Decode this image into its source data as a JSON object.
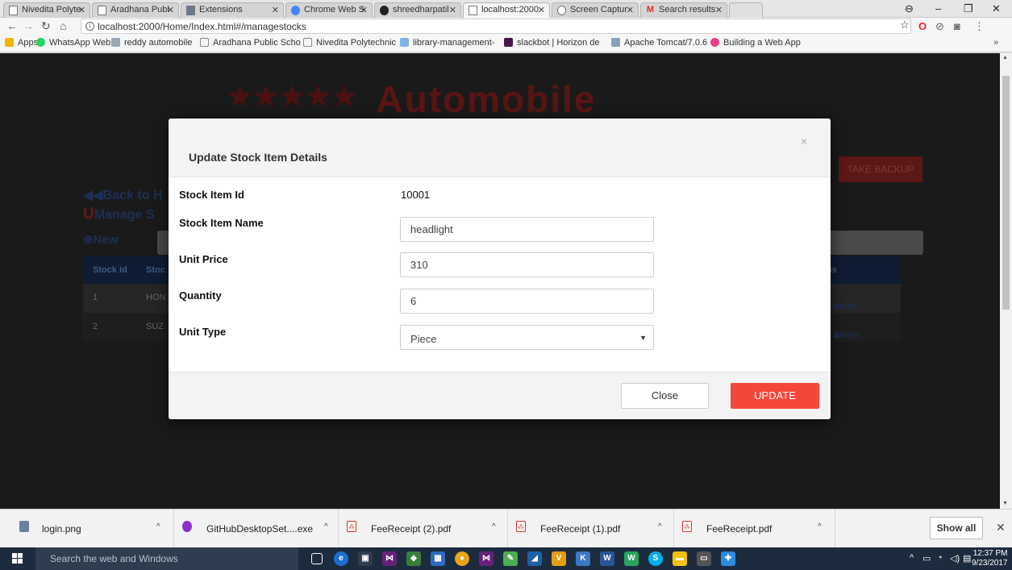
{
  "browser": {
    "tabs": [
      {
        "title": "Nivedita Polyte"
      },
      {
        "title": "Aradhana Publ"
      },
      {
        "title": "Extensions"
      },
      {
        "title": "Chrome Web S"
      },
      {
        "title": "shreedharpatil"
      },
      {
        "title": "localhost:2000"
      },
      {
        "title": "Screen Captur"
      },
      {
        "title": "Search results"
      }
    ],
    "url": "localhost:2000/Home/Index.html#/managestocks",
    "bookmarks": [
      {
        "label": "Apps",
        "color": "#f4b400"
      },
      {
        "label": "WhatsApp Web",
        "color": "#25d366"
      },
      {
        "label": "reddy automobile",
        "color": "#9aa7b5"
      },
      {
        "label": "Aradhana Public Scho",
        "color": "#bbbbbb"
      },
      {
        "label": "Nivedita Polytechnic",
        "color": "#bbbbbb"
      },
      {
        "label": "library-management-",
        "color": "#7fb3e6"
      },
      {
        "label": "slackbot | Horizon de",
        "color": "#4a154b"
      },
      {
        "label": "Apache Tomcat/7.0.6",
        "color": "#8aa0b8"
      },
      {
        "label": "Building a Web App",
        "color": "#e83e8c"
      }
    ]
  },
  "page": {
    "brand_stars": "★★★★★",
    "brand_name": "Automobile",
    "backup_button": "TAKE BACKUP",
    "back_link": "Back to H",
    "manage_link": "Manage S",
    "new_link": "New",
    "table": {
      "headers": [
        "Stock Id",
        "Stoc",
        "ns"
      ],
      "rows": [
        {
          "id": "1",
          "name": "HON",
          "action": "Delete"
        },
        {
          "id": "2",
          "name": "SUZ",
          "action": "Delete"
        }
      ]
    }
  },
  "modal": {
    "title": "Update Stock Item Details",
    "close_x": "×",
    "fields": {
      "stock_item_id_label": "Stock Item Id",
      "stock_item_id_value": "10001",
      "stock_item_name_label": "Stock Item Name",
      "stock_item_name_value": "headlight",
      "unit_price_label": "Unit Price",
      "unit_price_value": "310",
      "quantity_label": "Quantity",
      "quantity_value": "6",
      "unit_type_label": "Unit Type",
      "unit_type_value": "Piece"
    },
    "close_button": "Close",
    "update_button": "UPDATE"
  },
  "downloads": {
    "items": [
      {
        "name": "login.png",
        "color": "#6b7fa0"
      },
      {
        "name": "GitHubDesktopSet....exe",
        "color": "#8b2fc9"
      },
      {
        "name": "FeeReceipt (2).pdf",
        "color": "#d93025"
      },
      {
        "name": "FeeReceipt (1).pdf",
        "color": "#d93025"
      },
      {
        "name": "FeeReceipt.pdf",
        "color": "#d93025"
      }
    ],
    "show_all": "Show all"
  },
  "taskbar": {
    "search_placeholder": "Search the web and Windows",
    "time": "12:37 PM",
    "date": "9/23/2017"
  },
  "colors": {
    "accent_red": "#f4473a",
    "modal_bg": "#ffffff",
    "overlay": "#1a1a1a"
  }
}
